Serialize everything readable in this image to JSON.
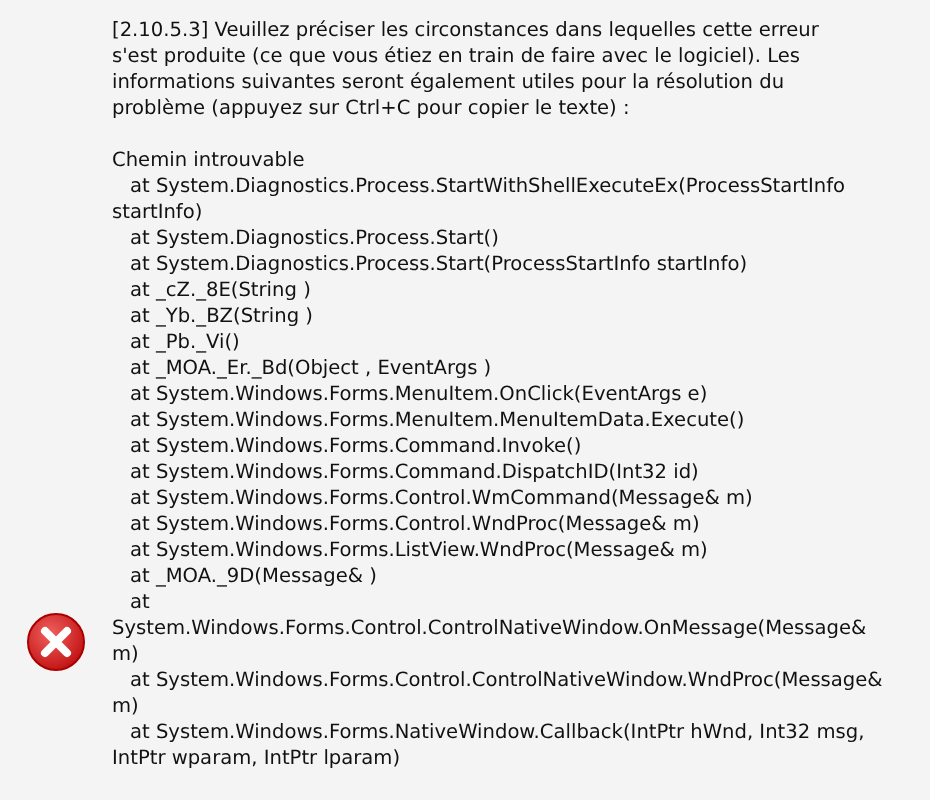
{
  "message": {
    "intro": "[2.10.5.3] Veuillez préciser les circonstances dans lequelles cette erreur s'est produite (ce que vous étiez en train de faire avec le logiciel). Les informations suivantes seront également utiles pour la résolution du problème (appuyez sur Ctrl+C pour copier le texte) :",
    "error": "Chemin introuvable",
    "stack": [
      "at System.Diagnostics.Process.StartWithShellExecuteEx(ProcessStartInfo startInfo)",
      "at System.Diagnostics.Process.Start()",
      "at System.Diagnostics.Process.Start(ProcessStartInfo startInfo)",
      "at _cZ._8E(String )",
      "at _Yb._BZ(String )",
      "at _Pb._Vi()",
      "at _MOA._Er._Bd(Object , EventArgs )",
      "at System.Windows.Forms.MenuItem.OnClick(EventArgs e)",
      "at System.Windows.Forms.MenuItem.MenuItemData.Execute()",
      "at System.Windows.Forms.Command.Invoke()",
      "at System.Windows.Forms.Command.DispatchID(Int32 id)",
      "at System.Windows.Forms.Control.WmCommand(Message& m)",
      "at System.Windows.Forms.Control.WndProc(Message& m)",
      "at System.Windows.Forms.ListView.WndProc(Message& m)",
      "at _MOA._9D(Message& )",
      "at System.Windows.Forms.Control.ControlNativeWindow.OnMessage(Message& m)",
      "at System.Windows.Forms.Control.ControlNativeWindow.WndProc(Message& m)",
      "at System.Windows.Forms.NativeWindow.Callback(IntPtr hWnd, Int32 msg, IntPtr wparam, IntPtr lparam)"
    ]
  }
}
